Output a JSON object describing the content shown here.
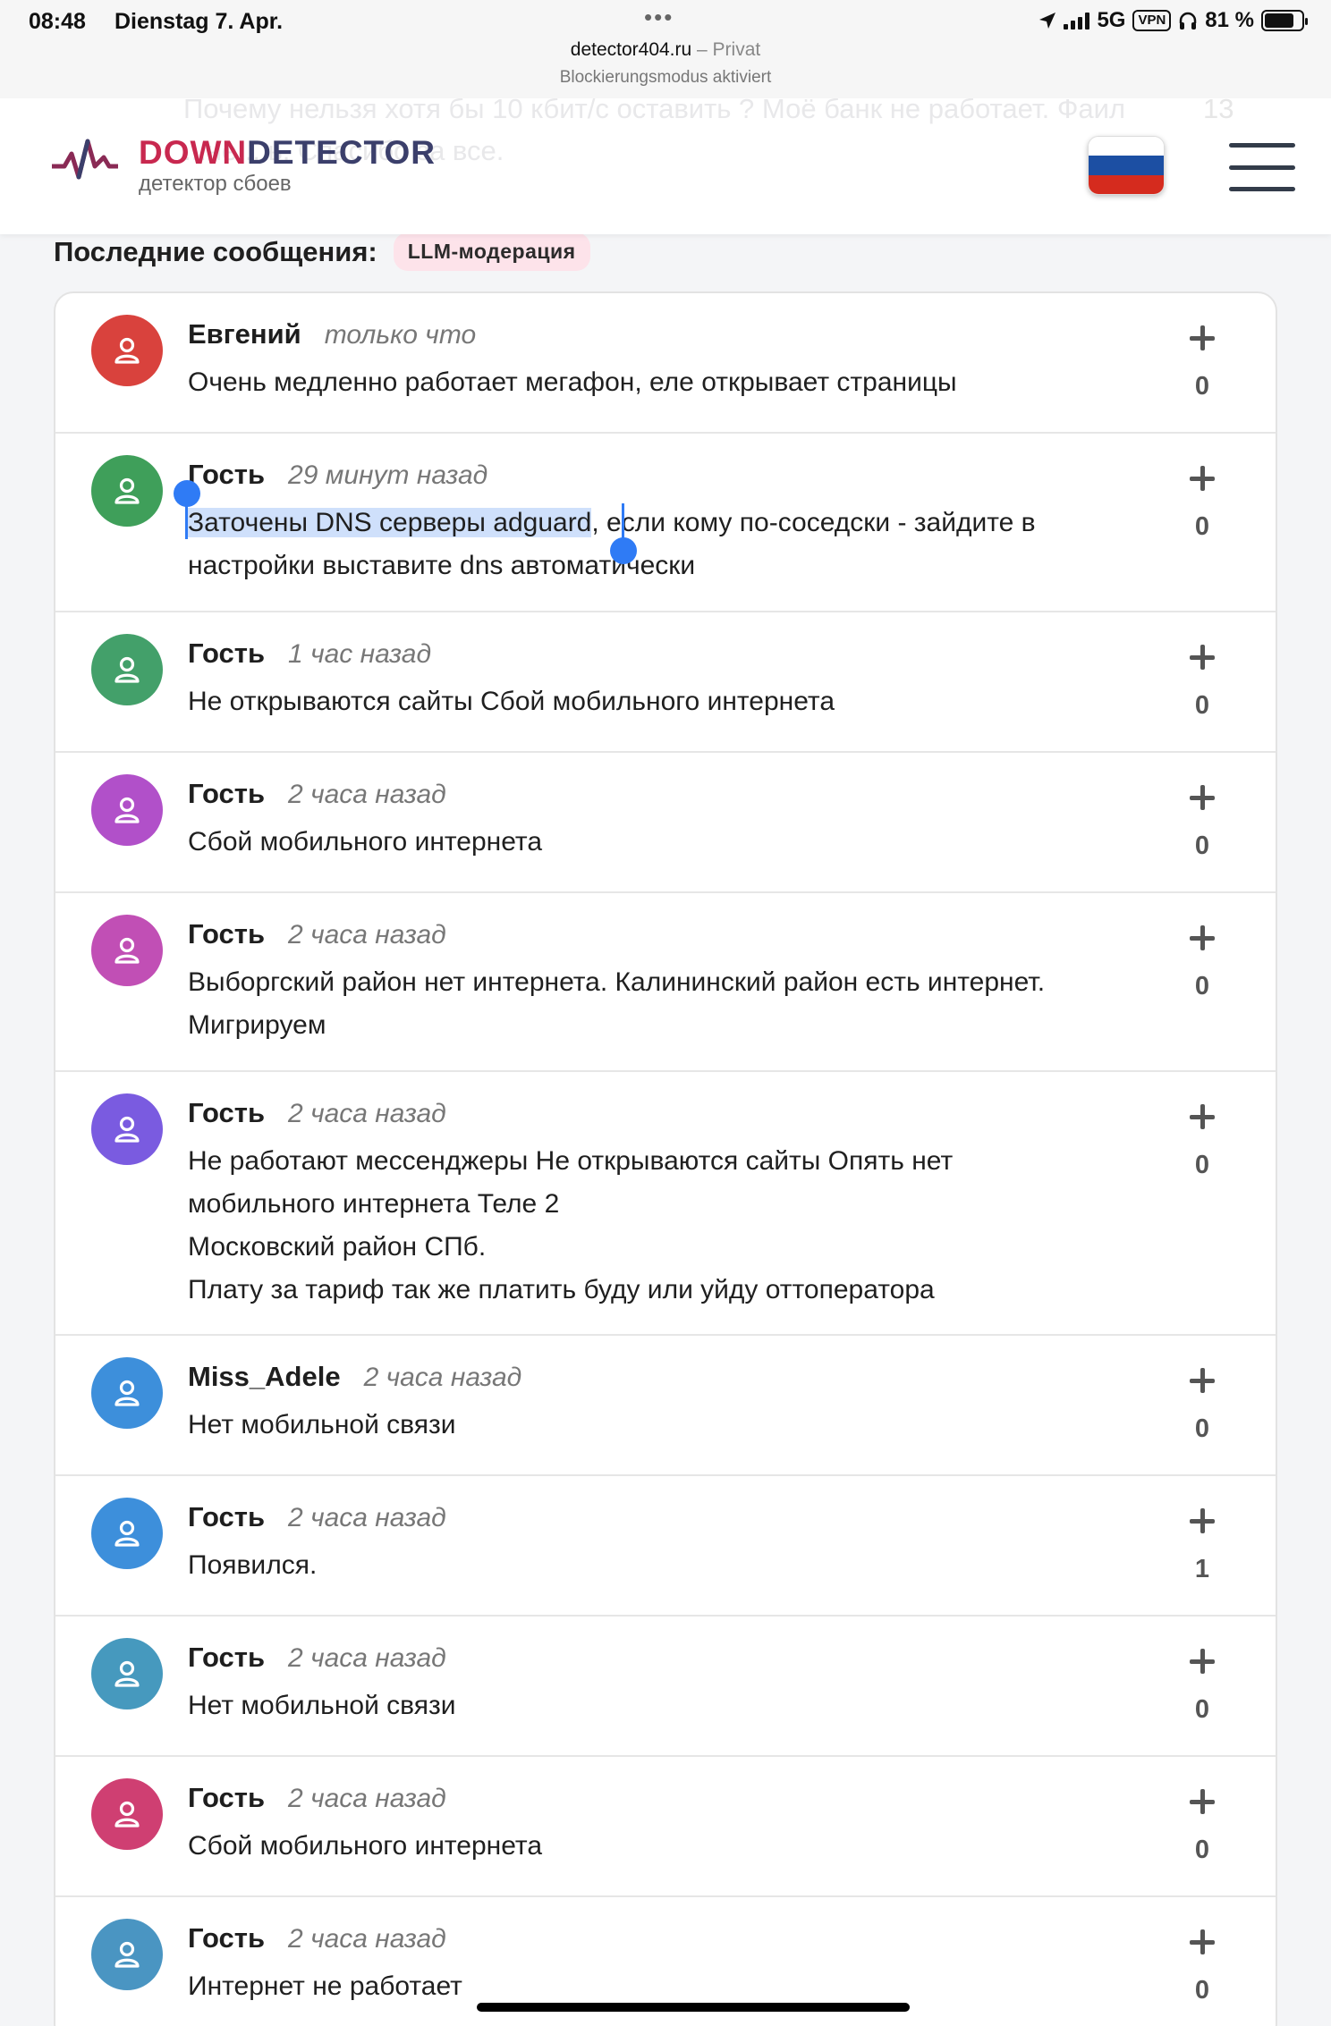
{
  "status_bar": {
    "time": "08:48",
    "date": "Dienstag 7. Apr.",
    "dots": "•••",
    "network": "5G",
    "vpn": "VPN",
    "battery": "81 %",
    "battery_level": 0.81
  },
  "browser": {
    "domain": "detector404.ru",
    "mode": " – Privat",
    "notice": "Blockierungsmodus aktiviert"
  },
  "header": {
    "logo_part1": "DOWN",
    "logo_part2": "DETECTOR",
    "subtitle": "детектор сбоев",
    "ghost_text_line1": "Почему нельзя хотя бы 10 кбит/с оставить ? Моё банк не работает. Фаил",
    "ghost_text_line2": "...не... ь. Спасибо за все.",
    "ghost_count": "13",
    "flag_colors": [
      "#ffffff",
      "#1c4fa3",
      "#d52b1e"
    ]
  },
  "section": {
    "title": "Последние сообщения:",
    "badge": "LLM-модерация"
  },
  "messages": [
    {
      "name": "Евгений",
      "time": "только что",
      "text": "Очень медленно работает мегафон, еле открывает страницы",
      "score": "0",
      "color": "#d9423d"
    },
    {
      "name": "Гость",
      "time": "29 минут назад",
      "text_selected": "Заточены DNS серверы adguard",
      "text_rest": ", если кому по-соседски - зайдите в\nнастройки выставите dns автоматически",
      "score": "0",
      "color": "#3f9f5a"
    },
    {
      "name": "Гость",
      "time": "1 час назад",
      "text": "Не открываются сайты Сбой мобильного интернета",
      "score": "0",
      "color": "#43a06a"
    },
    {
      "name": "Гость",
      "time": "2 часа назад",
      "text": "Сбой мобильного интернета",
      "score": "0",
      "color": "#b150c9"
    },
    {
      "name": "Гость",
      "time": "2 часа назад",
      "text": "Выборгский район нет интернета. Калининский район есть интернет.\nМигрируем",
      "score": "0",
      "color": "#c14fb5"
    },
    {
      "name": "Гость",
      "time": "2 часа назад",
      "text": "Не работают мессенджеры Не открываются сайты Опять нет\nмобильного интернета Теле 2\nМосковский район СПб.\nПлату за тариф так же платить буду или уйду оттоператора",
      "score": "0",
      "color": "#7a5be0"
    },
    {
      "name": "Miss_Adele",
      "time": "2 часа назад",
      "text": "Нет мобильной связи",
      "score": "0",
      "color": "#3d8fdb"
    },
    {
      "name": "Гость",
      "time": "2 часа назад",
      "text": "Появился.",
      "score": "1",
      "color": "#3d8fdb"
    },
    {
      "name": "Гость",
      "time": "2 часа назад",
      "text": "Нет мобильной связи",
      "score": "0",
      "color": "#4699be"
    },
    {
      "name": "Гость",
      "time": "2 часа назад",
      "text": "Сбой мобильного интернета",
      "score": "0",
      "color": "#cf3f72"
    },
    {
      "name": "Гость",
      "time": "2 часа назад",
      "text": "Интернет не работает",
      "score": "0",
      "color": "#4a95c2"
    }
  ]
}
